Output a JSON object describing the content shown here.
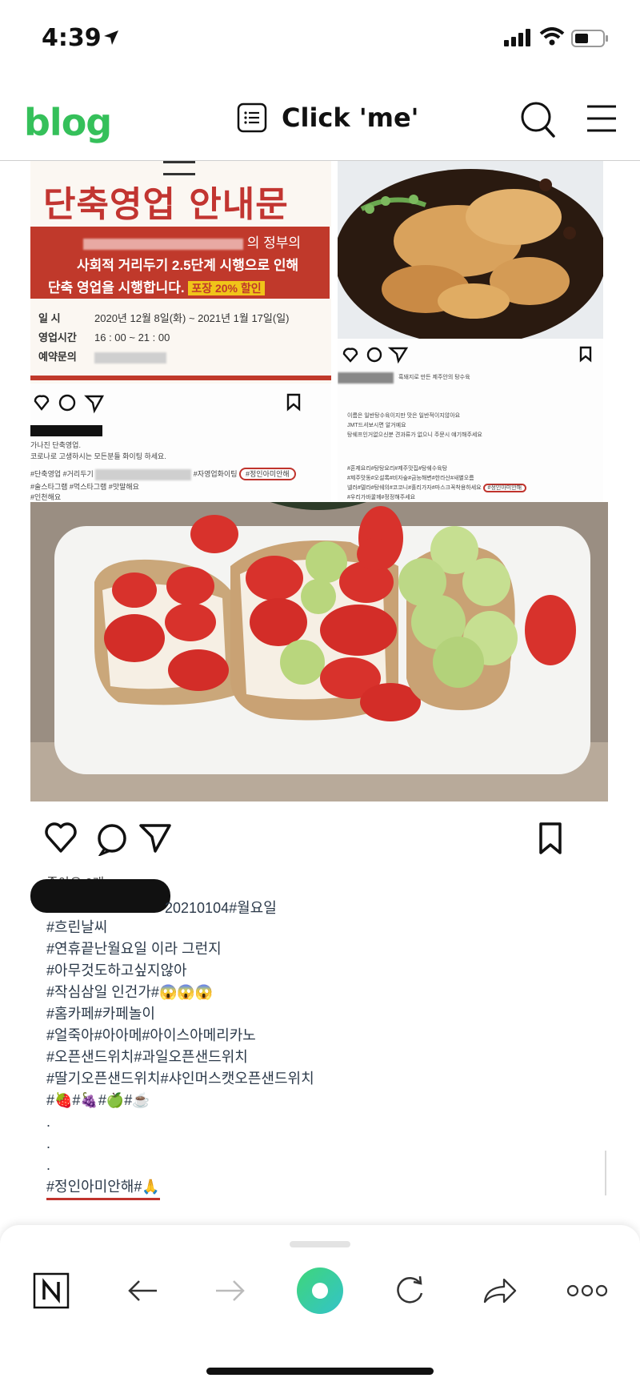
{
  "status_bar": {
    "time": "4:39"
  },
  "nav": {
    "logo": "blog",
    "title": "Click 'me'"
  },
  "post1": {
    "notice_title": "단축영업 안내문",
    "band_line1_suffix": "의 정부의",
    "band_line2": "사회적 거리두기 2.5단계 시행으로 인해",
    "band_line3": "단축 영업을 시행합니다.",
    "badge": "포장 20% 할인",
    "info_rows": [
      {
        "key": "일  시",
        "value": "2020년 12월 8일(화) ~ 2021년 1월 17일(일)"
      },
      {
        "key": "영업시간",
        "value": "16 : 00 ~ 21 : 00"
      },
      {
        "key": "예약문의",
        "value": ""
      }
    ],
    "caption_line1": "가나진 단축영업.",
    "caption_line2": "코로나로 고생하시는 모든분들 화이팅 하세요.",
    "caption_line3_a": "#단축영업 #거리두기",
    "caption_line3_b": "#자영업화이팅",
    "caption_line3_hl": "#정인아미안해",
    "caption_line4": "#술스타그램 #먹스타그램 #맛말해요",
    "caption_line5": "#인천해요"
  },
  "post2": {
    "caption_line1": "흑돼지로 만든 제주안의 탕수육",
    "caption_line2": "이름은 일반탕수육이지만 맛은 일반적이지않아요",
    "caption_line3": "JMT드셔보시면 알거예요",
    "caption_line4": "탕쉐프인거없으신분 견과류가 없으니 주문시 얘기해주세요",
    "caption_line5": "#혼제요리#탕탕요리#제주맛집#탕쉐수육탕",
    "caption_line6": "#제주맛동#오설록#비자숲#금능해변#한라산#새별오름",
    "caption_line7": "넬러#델라#탕쉐의#코코니#홀리가자#마스크꼭착용하세요",
    "caption_line7_hl": "#정인아미안해",
    "caption_line8": "#우리가바꿀께#정정해주세요"
  },
  "post3": {
    "likes": "좋아요 0개",
    "date_tags": "20210104#월요일",
    "hashtags": [
      "#흐린날씨",
      "#연휴끝난월요일 이라 그런지",
      "#아무것도하고싶지않아",
      "#작심삼일 인건가#😱😱😱",
      "#홈카페#카페놀이",
      "#얼죽아#아아메#아이스아메리카노",
      "#오픈샌드위치#과일오픈샌드위치",
      "#딸기오픈샌드위치#샤인머스캣오픈샌드위치",
      "#🍓#🍇#🍏#☕",
      ".",
      ".",
      ".",
      "#정인아미안해#🙏"
    ]
  },
  "toolbar": {
    "icons": [
      "naver-n-icon",
      "back-arrow-icon",
      "forward-arrow-icon",
      "green-dot-icon",
      "refresh-icon",
      "share-icon",
      "more-icon"
    ]
  },
  "colors": {
    "accent": "#35c05a",
    "notice_red": "#c0392b",
    "highlight": "#c0342d"
  }
}
